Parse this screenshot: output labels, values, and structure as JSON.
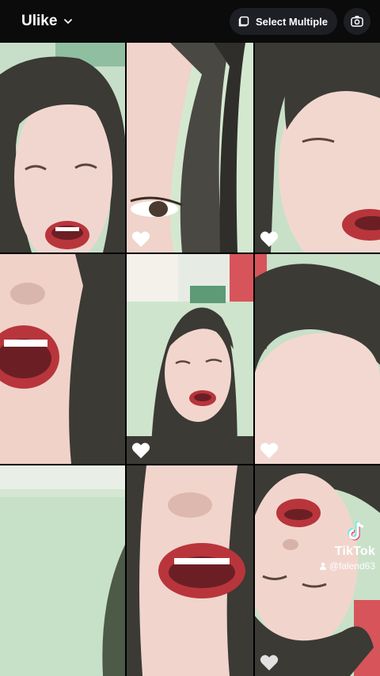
{
  "header": {
    "title": "Ulike",
    "select_multiple_label": "Select Multiple",
    "icons": {
      "title_dropdown": "chevron-down-icon",
      "select_multiple": "select-square-icon",
      "camera": "camera-icon"
    }
  },
  "grid": {
    "tiles": [
      {
        "id": 1,
        "liked": false
      },
      {
        "id": 2,
        "liked": true
      },
      {
        "id": 3,
        "liked": true
      },
      {
        "id": 4,
        "liked": false
      },
      {
        "id": 5,
        "liked": true
      },
      {
        "id": 6,
        "liked": true
      },
      {
        "id": 7,
        "liked": false
      },
      {
        "id": 8,
        "liked": false
      },
      {
        "id": 9,
        "liked": true
      }
    ]
  },
  "watermark": {
    "brand": "TikTok",
    "handle": "@falend63"
  },
  "colors": {
    "background": "#000000",
    "pill": "#1d1f24",
    "text": "#ffffff",
    "wall": "#bcd8c2",
    "skin": "#f1d6cf",
    "lips": "#b8353c",
    "hair": "#3b3a35"
  }
}
